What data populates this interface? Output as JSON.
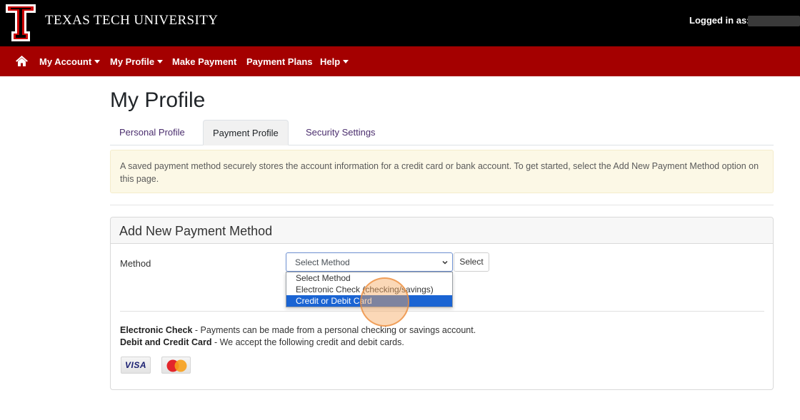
{
  "header": {
    "brand": "TEXAS TECH UNIVERSITY",
    "logged_in_label": "Logged in as:"
  },
  "nav": {
    "home_icon": "home-icon",
    "items": [
      {
        "label": "My Account",
        "has_caret": true
      },
      {
        "label": "My Profile",
        "has_caret": true
      },
      {
        "label": "Make Payment",
        "has_caret": false
      },
      {
        "label": "Payment Plans",
        "has_caret": false
      },
      {
        "label": "Help",
        "has_caret": true
      }
    ]
  },
  "page": {
    "title": "My Profile",
    "tabs": [
      {
        "label": "Personal Profile",
        "active": false
      },
      {
        "label": "Payment Profile",
        "active": true
      },
      {
        "label": "Security Settings",
        "active": false
      }
    ],
    "alert": "A saved payment method securely stores the account information for a credit card or bank account. To get started, select the Add New Payment Method option on this page."
  },
  "card": {
    "title": "Add New Payment Method",
    "method_label": "Method",
    "select_value": "Select Method",
    "select_button": "Select",
    "options": [
      "Select Method",
      "Electronic Check (checking/savings)",
      "Credit or Debit Card"
    ],
    "highlighted_option": "Credit or Debit Card",
    "info": [
      {
        "term": "Electronic Check",
        "desc": " - Payments can be made from a personal checking or savings account."
      },
      {
        "term": "Debit and Credit Card",
        "desc": " - We accept the following credit and debit cards."
      }
    ],
    "card_logos": [
      {
        "name": "visa-logo",
        "text": "VISA"
      },
      {
        "name": "mastercard-logo",
        "text": "MasterCard"
      }
    ]
  },
  "colors": {
    "navbar": "#a40000",
    "topbar": "#000000",
    "highlight": "#1a64d3",
    "tab_link": "#4b2e6e"
  }
}
